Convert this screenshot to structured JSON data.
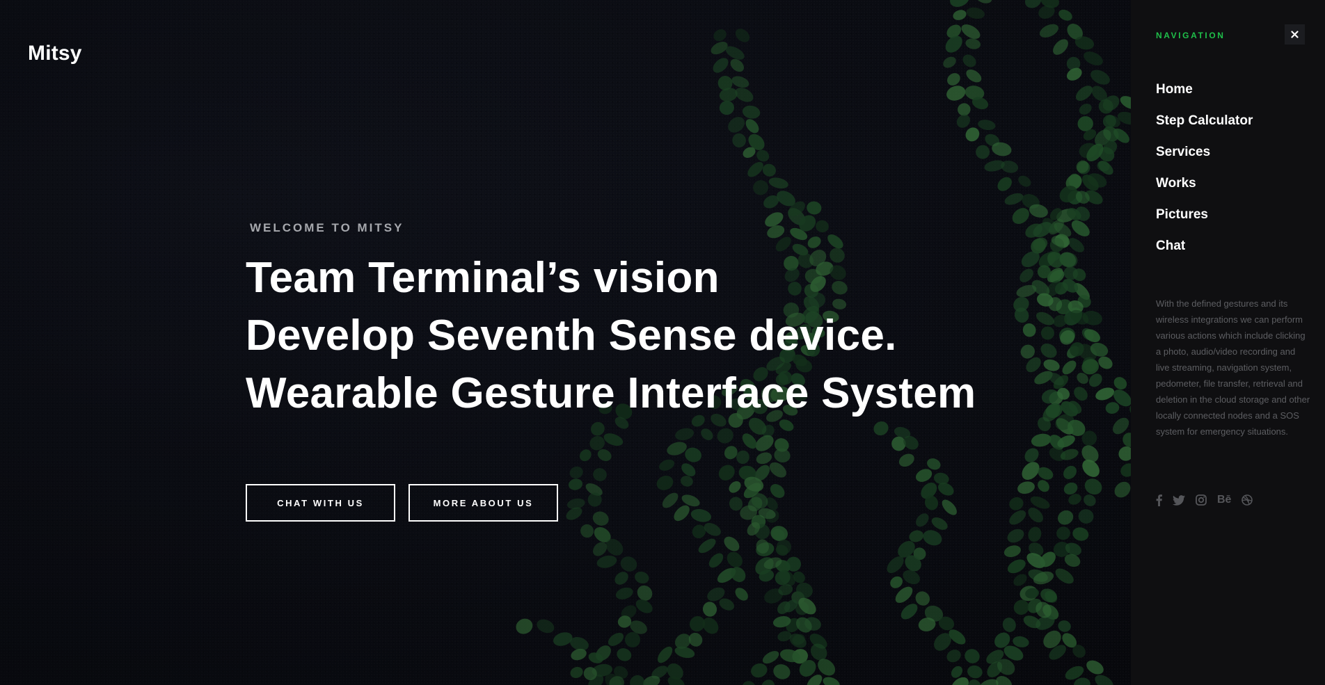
{
  "brand": {
    "logo": "Mitsy"
  },
  "hero": {
    "eyebrow": "WELCOME TO MITSY",
    "headline": [
      "Team Terminal’s vision",
      "Develop Seventh Sense device.",
      "Wearable Gesture Interface System"
    ],
    "buttons": {
      "chat": "CHAT WITH US",
      "about": "MORE ABOUT US"
    }
  },
  "nav": {
    "heading": "NAVIGATION",
    "close_icon": "close-icon",
    "items": [
      {
        "label": "Home"
      },
      {
        "label": "Step Calculator"
      },
      {
        "label": "Services"
      },
      {
        "label": "Works"
      },
      {
        "label": "Pictures"
      },
      {
        "label": "Chat"
      }
    ],
    "description": "With the defined gestures and its wireless integrations we can perform various actions which include clicking a photo, audio/video recording and live streaming, navigation system, pedometer, file transfer, retrieval and deletion in the cloud storage and other locally connected nodes and a SOS system for emergency situations.",
    "social": [
      {
        "icon": "facebook-icon"
      },
      {
        "icon": "twitter-icon"
      },
      {
        "icon": "instagram-icon"
      },
      {
        "icon": "behance-icon",
        "glyph": "Bē"
      },
      {
        "icon": "dribbble-icon"
      }
    ]
  },
  "colors": {
    "accent": "#1fbf4a",
    "panel": "#0f0f11",
    "background": "#0c0e15",
    "muted_text": "#5d5e62"
  }
}
